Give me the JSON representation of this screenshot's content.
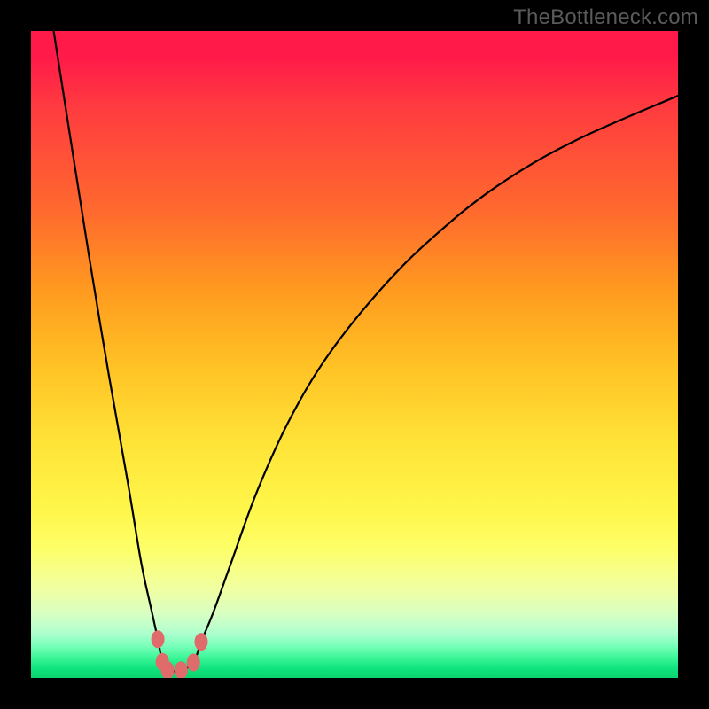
{
  "attribution": "TheBottleneck.com",
  "colors": {
    "frame": "#000000",
    "gradient_stops": [
      "#ff1a49",
      "#ff3c3f",
      "#ff6a2e",
      "#ff9a1f",
      "#ffc325",
      "#ffe438",
      "#fff64a",
      "#fdff68",
      "#f2ffa0",
      "#d9ffc2",
      "#b0ffcf",
      "#7affba",
      "#38f596",
      "#10e37e",
      "#0ad46f"
    ],
    "curve": "#000000",
    "marker_fill": "#e06b6b",
    "marker_stroke": "#b04848"
  },
  "chart_data": {
    "type": "line",
    "title": "",
    "xlabel": "",
    "ylabel": "",
    "xlim": [
      0,
      100
    ],
    "ylim": [
      0,
      100
    ],
    "grid": false,
    "legend": false,
    "series": [
      {
        "name": "bottleneck-curve",
        "x": [
          3.5,
          6,
          9,
          12,
          15,
          17,
          18.5,
          19.6,
          20.3,
          21.1,
          23.2,
          25.1,
          26.3,
          28.2,
          31,
          35,
          40,
          46,
          54,
          62,
          72,
          84,
          100
        ],
        "y": [
          100,
          84,
          65,
          47,
          30,
          18,
          11,
          6,
          2.5,
          1.2,
          1.2,
          2.4,
          5.6,
          10.2,
          18,
          29,
          40,
          50,
          60,
          68,
          76,
          83,
          90
        ]
      }
    ],
    "markers": [
      {
        "x": 19.6,
        "y": 6.0
      },
      {
        "x": 20.3,
        "y": 2.5
      },
      {
        "x": 21.1,
        "y": 1.2
      },
      {
        "x": 23.2,
        "y": 1.2
      },
      {
        "x": 25.1,
        "y": 2.4
      },
      {
        "x": 26.3,
        "y": 5.6
      }
    ]
  }
}
